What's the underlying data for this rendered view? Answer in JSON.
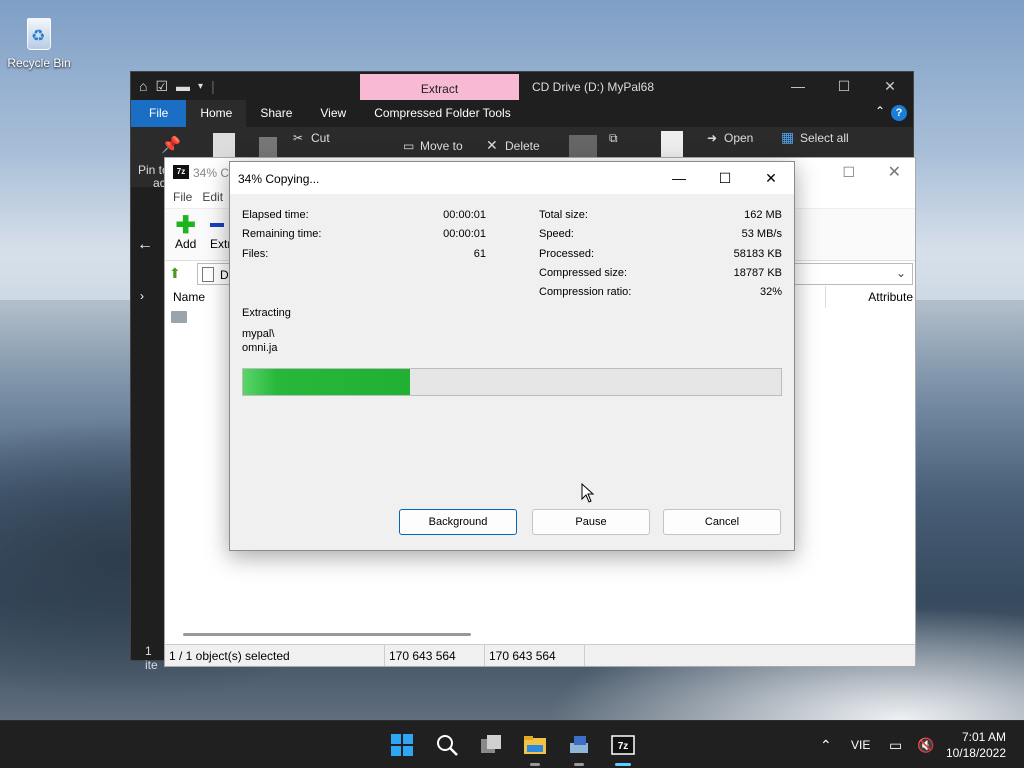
{
  "desktop": {
    "recycle_bin_label": "Recycle Bin"
  },
  "explorer": {
    "context_tab": "Extract",
    "title": "CD Drive (D:) MyPal68",
    "tabs": [
      "File",
      "Home",
      "Share",
      "View",
      "Compressed Folder Tools"
    ],
    "ribbon": {
      "pin_label_1": "Pin to",
      "pin_label_2": "ac",
      "cut": "Cut",
      "move_to": "Move to",
      "delete": "Delete",
      "open": "Open",
      "select_all": "Select all"
    },
    "status_text": "1 ite"
  },
  "sevenzip": {
    "title": "34% Co",
    "icon_text": "7z",
    "menu": [
      "File",
      "Edit"
    ],
    "toolbar": {
      "add": "Add",
      "extract": "Extr"
    },
    "address_text": "D",
    "columns": {
      "name": "Name",
      "attributes": "Attribute"
    },
    "status": {
      "selected": "1 / 1 object(s) selected",
      "size1": "170 643 564",
      "size2": "170 643 564"
    }
  },
  "dialog": {
    "title": "34% Copying...",
    "left_stats": [
      {
        "label": "Elapsed time:",
        "value": "00:00:01"
      },
      {
        "label": "Remaining time:",
        "value": "00:00:01"
      },
      {
        "label": "Files:",
        "value": "61"
      }
    ],
    "right_stats": [
      {
        "label": "Total size:",
        "value": "162 MB"
      },
      {
        "label": "Speed:",
        "value": "53 MB/s"
      },
      {
        "label": "Processed:",
        "value": "58183 KB"
      },
      {
        "label": "Compressed size:",
        "value": "18787 KB"
      },
      {
        "label": "Compression ratio:",
        "value": "32%"
      }
    ],
    "operation": "Extracting",
    "current_path": "mypal\\",
    "current_file": "omni.ja",
    "progress_percent": 31,
    "buttons": {
      "background": "Background",
      "pause": "Pause",
      "cancel": "Cancel"
    }
  },
  "taskbar": {
    "language": "VIE",
    "time": "7:01 AM",
    "date": "10/18/2022"
  },
  "colors": {
    "progress_green": "#20b034",
    "extract_tab": "#f7b9d4",
    "file_tab": "#1a6fc4",
    "taskbar": "#202020"
  }
}
